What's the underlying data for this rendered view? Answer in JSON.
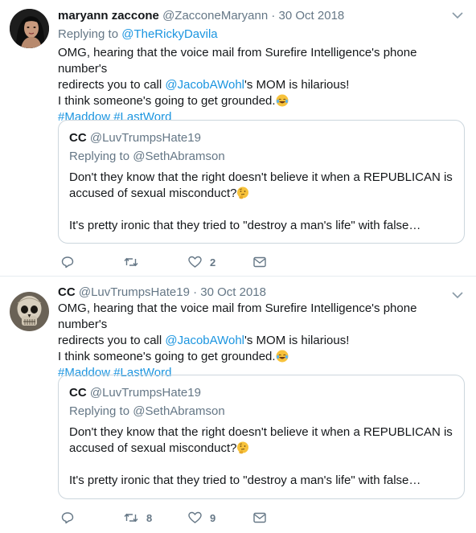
{
  "tweets": [
    {
      "name": "maryann zaccone",
      "handle": "@ZacconeMaryann",
      "separator": "·",
      "date": "30 Oct 2018",
      "replying_prefix": "Replying to",
      "replying_to": "@TheRickyDavila",
      "avatar_icon": "woman-portrait-avatar",
      "text": {
        "line1": "OMG, hearing that the voice mail from Surefire Intelligence's phone number's",
        "line2_pre": "redirects you to call ",
        "line2_mention": "@JacobAWohl",
        "line2_post": "'s MOM is hilarious!",
        "line3": "I think someone's going to get grounded.",
        "hashtags": "#Maddow #LastWord"
      },
      "quote": {
        "name": "CC",
        "handle": "@LuvTrumpsHate19",
        "replying_prefix": "Replying to",
        "replying_to": "@SethAbramson",
        "line1": "Don't they know that the right doesn't believe it when a REPUBLICAN is",
        "line2": "accused of sexual misconduct?",
        "line3": "It's pretty ironic that they tried to \"destroy a man's life\" with false…"
      },
      "actions": {
        "reply_count": "",
        "retweet_count": "",
        "like_count": "2"
      }
    },
    {
      "name": "CC",
      "handle": "@LuvTrumpsHate19",
      "separator": "·",
      "date": "30 Oct 2018",
      "avatar_icon": "skull-avatar",
      "text": {
        "line1": "OMG, hearing that the voice mail from Surefire Intelligence's phone number's",
        "line2_pre": "redirects you to call ",
        "line2_mention": "@JacobAWohl",
        "line2_post": "'s MOM is hilarious!",
        "line3": "I think someone's going to get grounded.",
        "hashtags": "#Maddow #LastWord"
      },
      "quote": {
        "name": "CC",
        "handle": "@LuvTrumpsHate19",
        "replying_prefix": "Replying to",
        "replying_to": "@SethAbramson",
        "line1": "Don't they know that the right doesn't believe it when a REPUBLICAN is",
        "line2": "accused of sexual misconduct?",
        "line3": "It's pretty ironic that they tried to \"destroy a man's life\" with false…"
      },
      "actions": {
        "reply_count": "",
        "retweet_count": "8",
        "like_count": "9"
      }
    }
  ],
  "colors": {
    "link": "#1b95e0",
    "secondary": "#657786",
    "border": "#ccd6dd"
  },
  "icons": [
    "reply-icon",
    "retweet-icon",
    "like-icon",
    "message-icon",
    "chevron-down-icon",
    "tears-of-joy-emoji",
    "thinking-face-emoji"
  ]
}
